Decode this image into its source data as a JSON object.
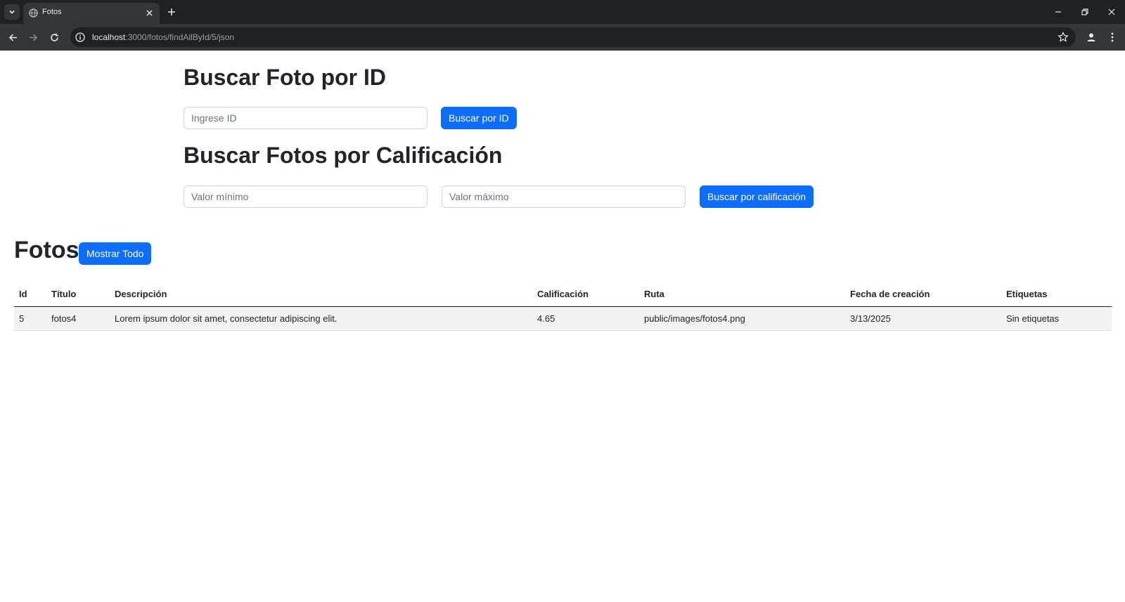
{
  "browser": {
    "tab_title": "Fotos",
    "url_host": "localhost",
    "url_rest": ":3000/fotos/findAllById/5/json"
  },
  "search_id": {
    "title": "Buscar Foto por ID",
    "input_placeholder": "Ingrese ID",
    "button_label": "Buscar por ID"
  },
  "search_rating": {
    "title": "Buscar Fotos por Calificación",
    "min_placeholder": "Valor mínimo",
    "max_placeholder": "Valor máximo",
    "button_label": "Buscar por calificación"
  },
  "fotos": {
    "title": "Fotos",
    "show_all_label": "Mostrar Todo",
    "columns": [
      "Id",
      "Título",
      "Descripción",
      "Calificación",
      "Ruta",
      "Fecha de creación",
      "Etiquetas"
    ],
    "rows": [
      {
        "id": "5",
        "titulo": "fotos4",
        "descripcion": "Lorem ipsum dolor sit amet, consectetur adipiscing elit.",
        "calificacion": "4.65",
        "ruta": "public/images/fotos4.png",
        "fecha": "3/13/2025",
        "etiquetas": "Sin etiquetas"
      }
    ]
  },
  "icons": {
    "tab_favicon": "globe-icon",
    "tab_close": "close-icon",
    "new_tab": "plus-icon",
    "back": "arrow-left-icon",
    "forward": "arrow-right-icon",
    "reload": "reload-icon",
    "site_info": "info-icon",
    "bookmark": "star-icon",
    "profile": "person-icon",
    "menu": "kebab-menu-icon"
  },
  "colors": {
    "primary": "#0d6efd",
    "row_bg": "#f2f2f2",
    "chrome_dark": "#202124",
    "chrome_toolbar": "#35363a"
  }
}
